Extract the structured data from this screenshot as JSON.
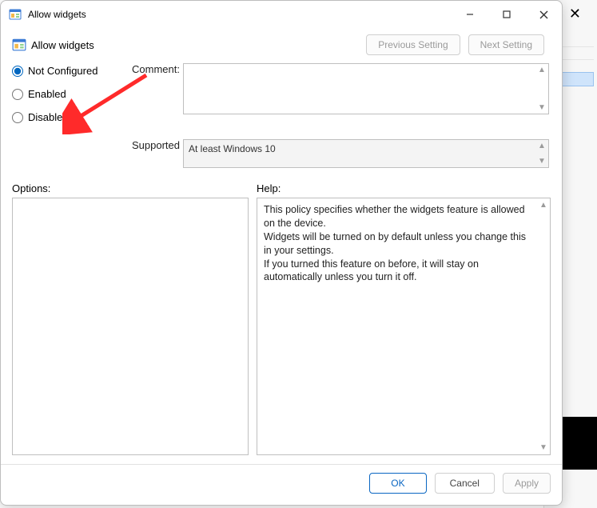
{
  "window": {
    "title": "Allow widgets"
  },
  "header": {
    "subtitle": "Allow widgets"
  },
  "nav": {
    "prev": "Previous Setting",
    "next": "Next Setting"
  },
  "radios": {
    "not_configured": "Not Configured",
    "enabled": "Enabled",
    "disabled": "Disabled"
  },
  "labels": {
    "comment": "Comment:",
    "supported_on": "Supported on:",
    "options": "Options:",
    "help": "Help:"
  },
  "supported_on": "At least Windows 10",
  "help_text": "This policy specifies whether the widgets feature is allowed on the device.\nWidgets will be turned on by default unless you change this in your settings.\nIf you turned this feature on before, it will stay on automatically unless you turn it off.",
  "footer": {
    "ok": "OK",
    "cancel": "Cancel",
    "apply": "Apply"
  },
  "bg_close": "✕"
}
